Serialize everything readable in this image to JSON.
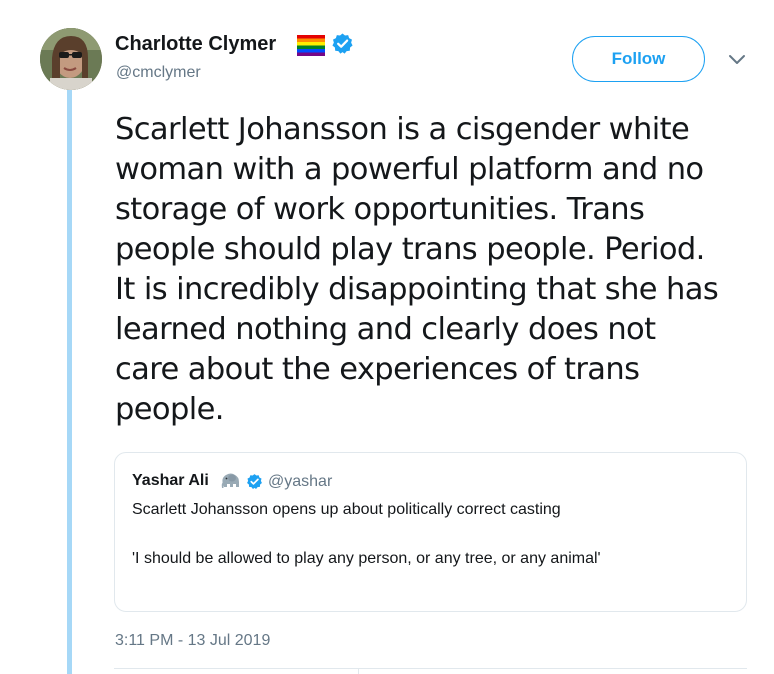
{
  "author": {
    "name": "Charlotte Clymer",
    "handle": "@cmclymer",
    "avatar_icon": "avatar",
    "flag_icon": "rainbow-flag-icon",
    "verified_icon": "verified-badge-icon"
  },
  "actions": {
    "follow_label": "Follow",
    "more_icon": "chevron-down-icon"
  },
  "tweet": {
    "lines": [
      "Scarlett Johansson is a cisgender white",
      "woman with a powerful platform and no",
      "storage of work opportunities. Trans",
      "people should play trans people. Period.",
      "It is incredibly disappointing that she has",
      "learned nothing and clearly does not",
      "care about the experiences of trans",
      "people."
    ],
    "timestamp": "3:11 PM - 13 Jul 2019"
  },
  "quote": {
    "name": "Yashar Ali",
    "emoji_icon": "elephant-icon",
    "verified_icon": "verified-badge-icon",
    "handle": "@yashar",
    "line1": "Scarlett Johansson opens up about politically correct casting",
    "line2": "'I should be allowed to play any person, or any tree, or any animal'"
  },
  "colors": {
    "accent": "#1da1f2",
    "thread_line": "#a6d8f7",
    "muted_text": "#657786",
    "border": "#e1e8ed"
  }
}
